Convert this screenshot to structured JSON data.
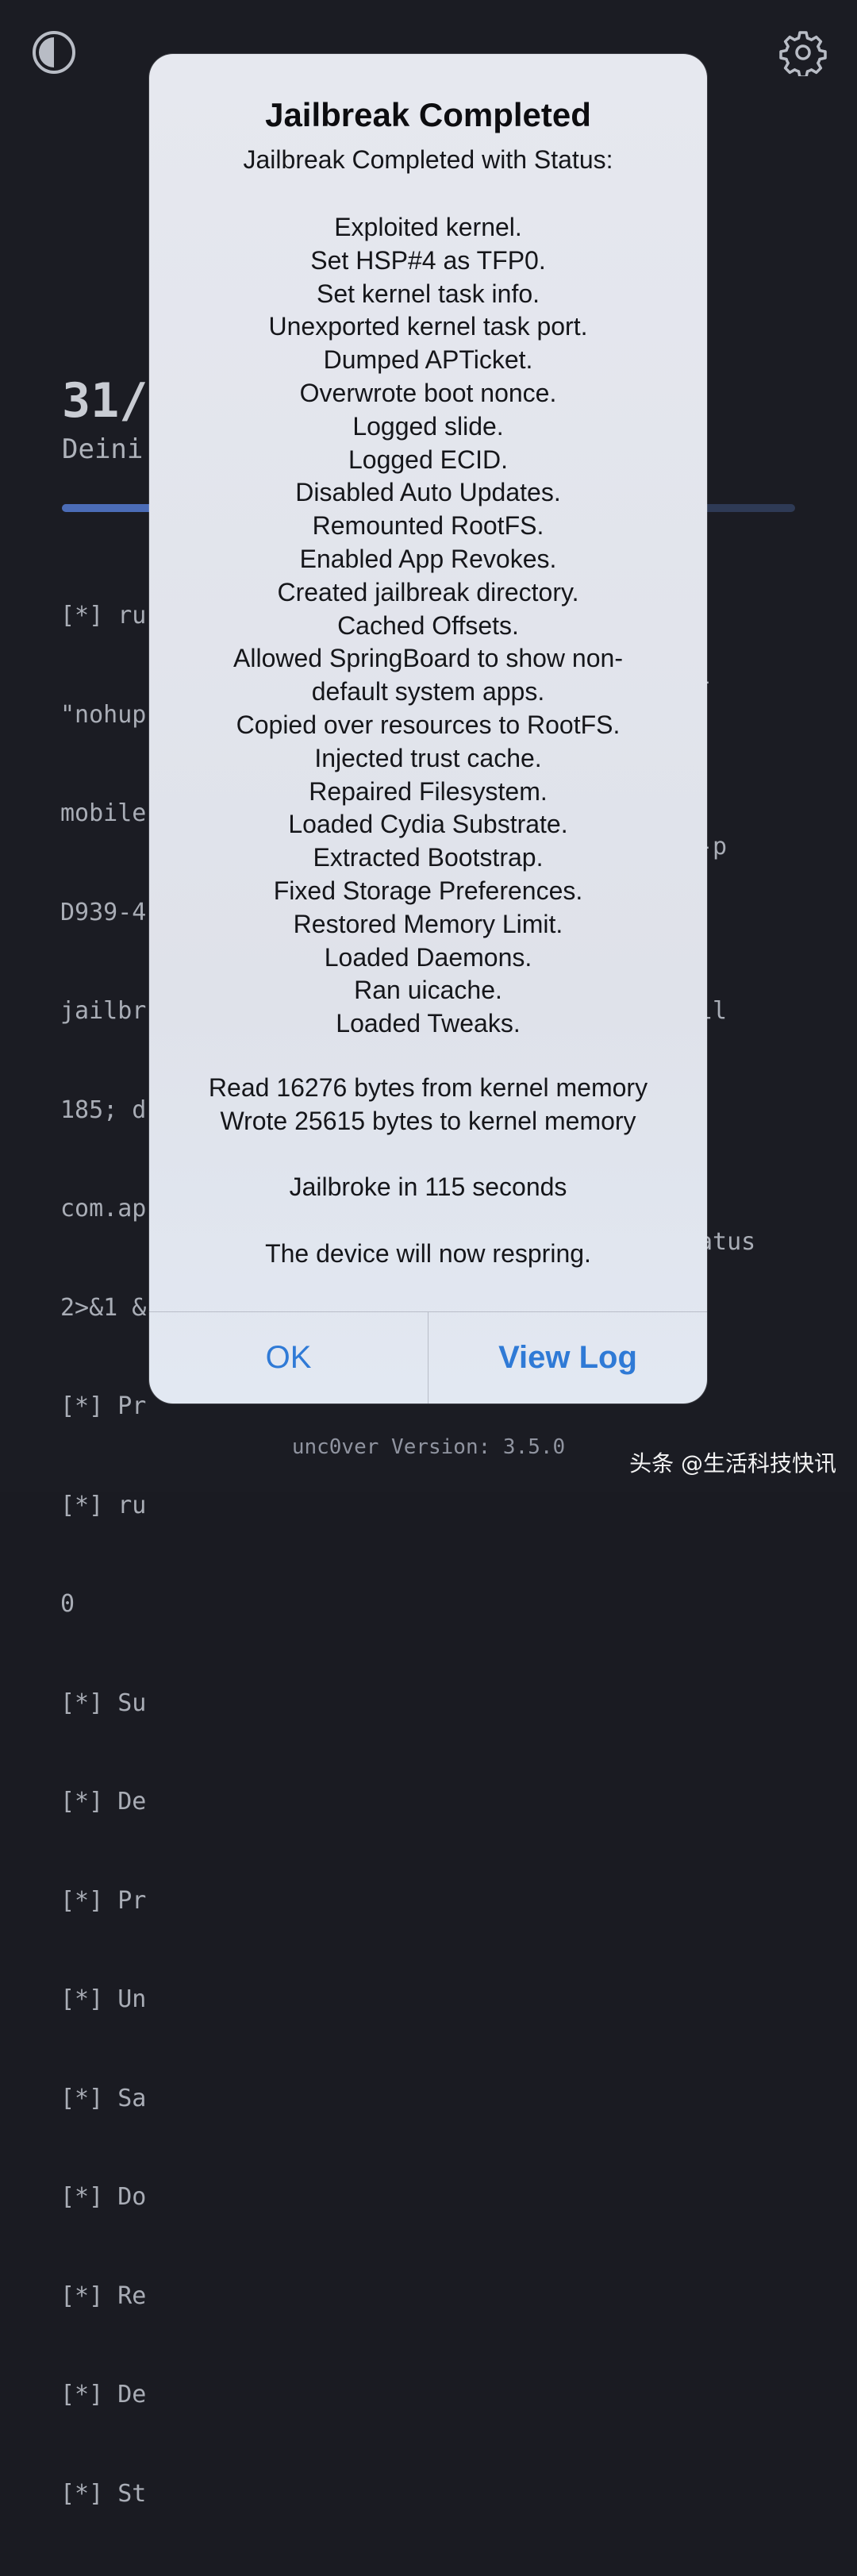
{
  "app": {
    "progress_count": "31/",
    "progress_status": "Deini",
    "progress_fraction": 0.31,
    "version": "unc0ver Version: 3.5.0",
    "watermark": "头条 @生活科技快讯",
    "icons": {
      "top_left": "contrast-icon",
      "top_right": "gear-icon"
    },
    "colors": {
      "background": "#1b1c23",
      "progress": "#4b6cb7",
      "link": "#2f7ad6"
    }
  },
  "log": {
    "left_lines": [
      "[*] ru",
      "\"nohup",
      "mobile",
      "D939-4",
      "jailbr",
      "185; d",
      "com.ap",
      "2>&1 &",
      "[*] Pr",
      "[*] ru",
      "0",
      "[*] Su",
      "[*] De",
      "[*] Pr",
      "[*] Un",
      "[*] Sa",
      "[*] Do",
      "[*] Re",
      "[*] De",
      "[*] St"
    ],
    "right_lines": [
      "-",
      "",
      "-p",
      "",
      "ll",
      "",
      "",
      "atus"
    ]
  },
  "dialog": {
    "title": "Jailbreak Completed",
    "subtitle": "Jailbreak Completed with Status:",
    "status_items": [
      "Exploited kernel.",
      "Set HSP#4 as TFP0.",
      "Set kernel task info.",
      "Unexported kernel task port.",
      "Dumped APTicket.",
      "Overwrote boot nonce.",
      "Logged slide.",
      "Logged ECID.",
      "Disabled Auto Updates.",
      "Remounted RootFS.",
      "Enabled App Revokes.",
      "Created jailbreak directory.",
      "Cached Offsets.",
      "Allowed SpringBoard to show non-",
      "default system apps.",
      "Copied over resources to RootFS.",
      "Injected trust cache.",
      "Repaired Filesystem.",
      "Loaded Cydia Substrate.",
      "Extracted Bootstrap.",
      "Fixed Storage Preferences.",
      "Restored Memory Limit.",
      "Loaded Daemons.",
      "Ran uicache.",
      "Loaded Tweaks."
    ],
    "read_bytes": "Read 16276 bytes from kernel memory",
    "wrote_bytes": "Wrote 25615 bytes to kernel memory",
    "duration": "Jailbroke in 115 seconds",
    "respring": "The device will now respring.",
    "ok_label": "OK",
    "view_log_label": "View Log"
  }
}
